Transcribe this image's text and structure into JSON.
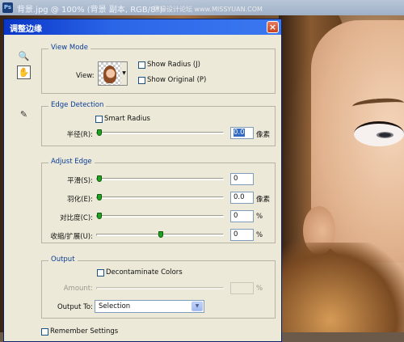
{
  "app": {
    "ps_badge": "Ps",
    "document_title": "背景.jpg @ 100% (背景 副本, RGB/8*)",
    "watermark": "思缘设计论坛  www.MISSYUAN.COM"
  },
  "dialog": {
    "title": "调整边缘",
    "close": "×",
    "tools": {
      "zoom": "🔍",
      "hand": "✋",
      "brush": "✎"
    },
    "view_mode": {
      "legend": "View Mode",
      "view_label": "View:",
      "show_radius": "Show Radius (J)",
      "show_original": "Show Original (P)"
    },
    "edge_detection": {
      "legend": "Edge Detection",
      "smart_radius": "Smart Radius",
      "radius_label": "半径(R):",
      "radius_value": "0.0",
      "radius_unit": "像素"
    },
    "adjust_edge": {
      "legend": "Adjust Edge",
      "rows": [
        {
          "label": "平滑(S):",
          "value": "0",
          "unit": "",
          "level": 0
        },
        {
          "label": "羽化(E):",
          "value": "0.0",
          "unit": "像素",
          "level": 0
        },
        {
          "label": "对比度(C):",
          "value": "0",
          "unit": "%",
          "level": 0
        },
        {
          "label": "收缩/扩展(U):",
          "value": "0",
          "unit": "%",
          "level": 0.5
        }
      ]
    },
    "output": {
      "legend": "Output",
      "decontaminate": "Decontaminate Colors",
      "amount_label": "Amount:",
      "amount_unit": "%",
      "output_to_label": "Output To:",
      "output_to_value": "Selection",
      "dropdown_arrow": "▼"
    },
    "remember_settings": "Remember Settings"
  }
}
